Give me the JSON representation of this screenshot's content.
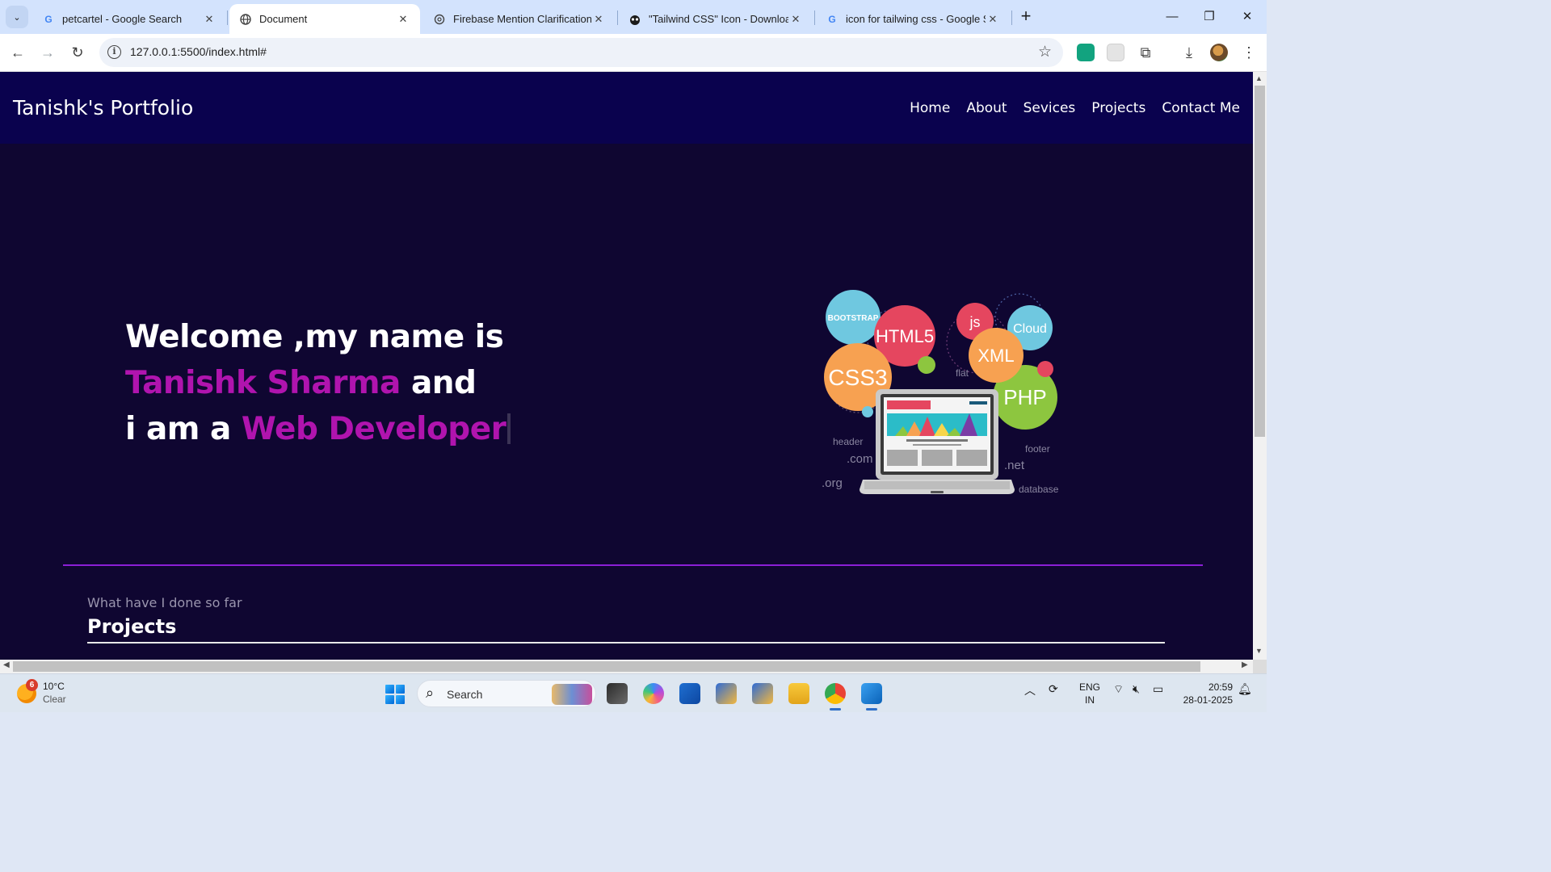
{
  "browser": {
    "tabs": [
      {
        "label": "petcartel - Google Search",
        "favicon": "google-g-icon",
        "active": false
      },
      {
        "label": "Document",
        "favicon": "globe-icon",
        "active": true
      },
      {
        "label": "Firebase Mention Clarification",
        "favicon": "openai-icon",
        "active": false
      },
      {
        "label": "\"Tailwind CSS\" Icon - Download",
        "favicon": "icons8-icon",
        "active": false
      },
      {
        "label": "icon for tailwing css - Google Se",
        "favicon": "google-g-icon",
        "active": false
      }
    ],
    "url": "127.0.0.1:5500/index.html#",
    "colors": {
      "tabstrip": "#d3e3fd",
      "active_tab": "#ffffff"
    }
  },
  "site": {
    "brand": "Tanishk's Portfolio",
    "nav": [
      "Home",
      "About",
      "Sevices",
      "Projects",
      "Contact Me"
    ],
    "hero": {
      "line1": "Welcome ,my name is",
      "name": "Tanishk Sharma",
      "and": "and",
      "prefix": "i am a",
      "role": "Web Developer"
    },
    "art_labels": {
      "bootstrap": "BOOTSTRAP",
      "html5": "HTML5",
      "js": "js",
      "cloud": "Cloud",
      "xml": "XML",
      "css3": "CSS3",
      "php": "PHP",
      "flat": "flat",
      "header": "header",
      "com": ".com",
      "org": ".org",
      "footer": "footer",
      "net": ".net",
      "database": "database"
    },
    "section": {
      "subtitle": "What have I done so far",
      "title": "Projects"
    },
    "colors": {
      "page_bg": "#0f0631",
      "nav_bg": "#0a024e",
      "highlight": "#b014ae",
      "divider": "#8b1fd6"
    }
  },
  "taskbar": {
    "weather": {
      "badge": "6",
      "temp": "10°C",
      "condition": "Clear"
    },
    "search_placeholder": "Search",
    "lang": [
      "ENG",
      "IN"
    ],
    "time": "20:59",
    "date": "28-01-2025"
  }
}
